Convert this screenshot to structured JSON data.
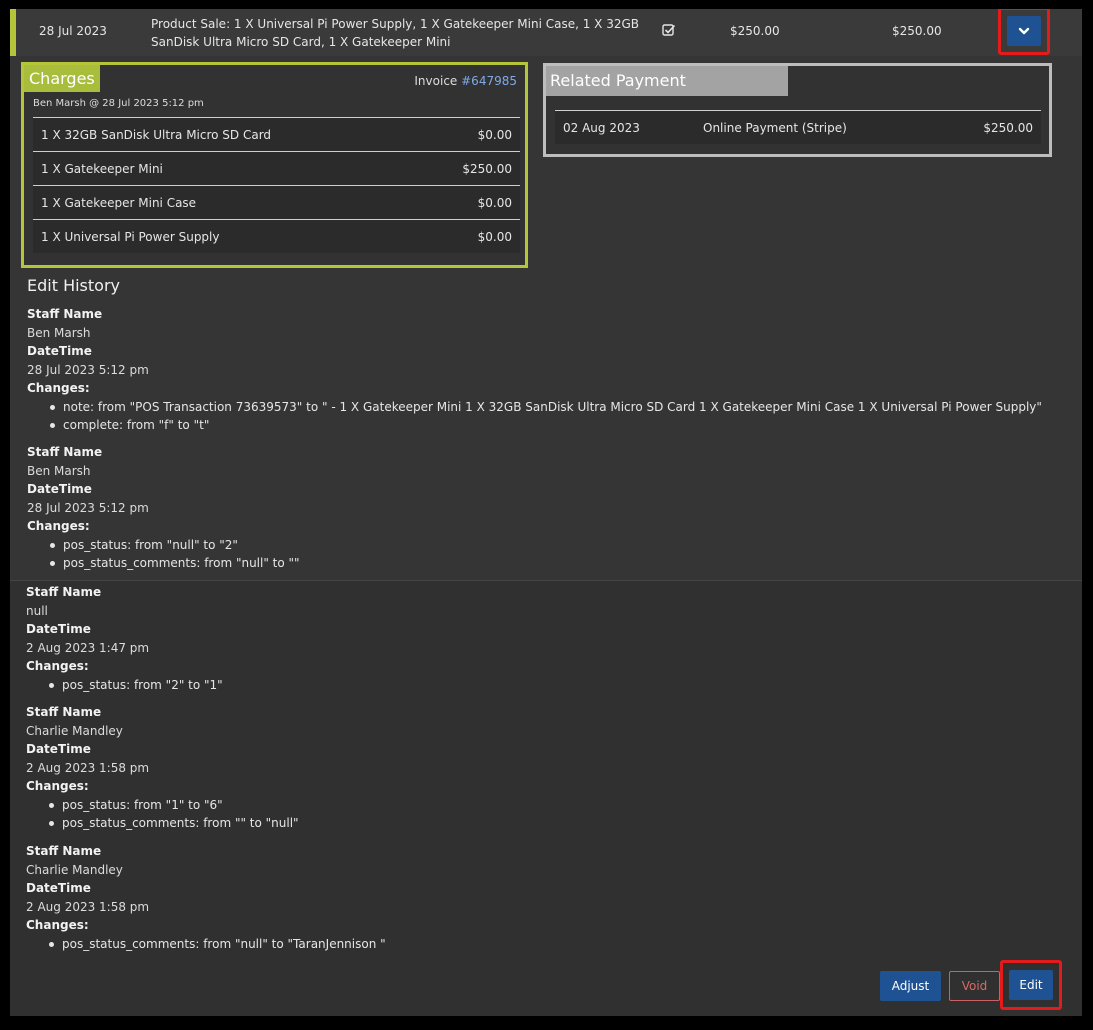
{
  "transaction": {
    "date": "28 Jul 2023",
    "description": "Product Sale: 1 X Universal Pi Power Supply, 1 X Gatekeeper Mini Case, 1 X 32GB SanDisk Ultra Micro SD Card, 1 X Gatekeeper Mini",
    "amount": "$250.00",
    "total": "$250.00",
    "accent_color": "#b5c53a"
  },
  "charges": {
    "title": "Charges",
    "invoice_label": "Invoice",
    "invoice_number": "#647985",
    "charged_by": "Ben Marsh @ 28 Jul 2023 5:12 pm",
    "items": [
      {
        "name": "1 X 32GB SanDisk Ultra Micro SD Card",
        "price": "$0.00"
      },
      {
        "name": "1 X Gatekeeper Mini",
        "price": "$250.00"
      },
      {
        "name": "1 X Gatekeeper Mini Case",
        "price": "$0.00"
      },
      {
        "name": "1 X Universal Pi Power Supply",
        "price": "$0.00"
      }
    ]
  },
  "payment": {
    "title": "Related Payment",
    "date": "02 Aug 2023",
    "method": "Online Payment (Stripe)",
    "amount": "$250.00"
  },
  "history": {
    "title": "Edit History",
    "staff_label": "Staff Name",
    "datetime_label": "DateTime",
    "changes_label": "Changes:",
    "entries": [
      {
        "staff": "Ben Marsh",
        "datetime": "28 Jul 2023 5:12 pm",
        "changes": [
          "note: from \"POS Transaction 73639573\" to \" - 1 X Gatekeeper Mini 1 X 32GB SanDisk Ultra Micro SD Card 1 X Gatekeeper Mini Case 1 X Universal Pi Power Supply\"",
          "complete: from \"f\" to \"t\""
        ]
      },
      {
        "staff": "Ben Marsh",
        "datetime": "28 Jul 2023 5:12 pm",
        "changes": [
          "pos_status: from \"null\" to \"2\"",
          "pos_status_comments: from \"null\" to \"\""
        ]
      },
      {
        "staff": "null",
        "datetime": "2 Aug 2023 1:47 pm",
        "changes": [
          "pos_status: from \"2\" to \"1\""
        ]
      },
      {
        "staff": "Charlie Mandley",
        "datetime": "2 Aug 2023 1:58 pm",
        "changes": [
          "pos_status: from \"1\" to \"6\"",
          "pos_status_comments: from \"\" to \"null\""
        ]
      },
      {
        "staff": "Charlie Mandley",
        "datetime": "2 Aug 2023 1:58 pm",
        "changes": [
          "pos_status_comments: from \"null\" to \"TaranJennison \""
        ]
      }
    ]
  },
  "actions": {
    "adjust": "Adjust",
    "void": "Void",
    "edit": "Edit"
  },
  "icons": {
    "expand": "chevron-down-icon",
    "complete": "checkbox-checked-icon"
  },
  "colors": {
    "primary_button": "#1f5292",
    "highlight_box": "#e31b1b",
    "charges_accent": "#a8bd3b",
    "payment_accent": "#a3a3a3"
  }
}
